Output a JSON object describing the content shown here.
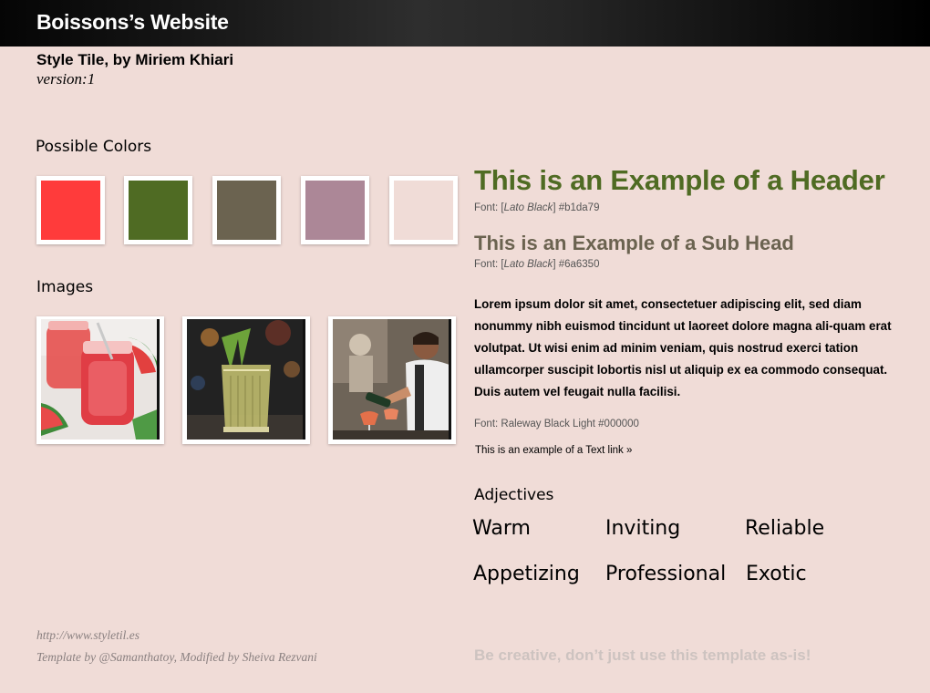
{
  "header": {
    "site_title": "Boissons’s Website"
  },
  "tile": {
    "author_line": "Style Tile, by Miriem Khiari",
    "version": "version:1"
  },
  "colors": {
    "label": "Possible Colors",
    "swatches": [
      {
        "hex": "#ff3b3b"
      },
      {
        "hex": "#4f6b23"
      },
      {
        "hex": "#6b6350"
      },
      {
        "hex": "#ac8797"
      },
      {
        "hex": "#f0dcd7"
      }
    ]
  },
  "images": {
    "label": "Images",
    "items": [
      "watermelon-juice-jars",
      "cocktail-glass",
      "bartender-pouring"
    ]
  },
  "typography": {
    "header_text": "This is an Example of a Header",
    "header_color": "#4f6b23",
    "header_font_prefix": "Font: [",
    "header_font_name": "Lato Black",
    "header_font_suffix": "]  #b1da79",
    "subhead_text": "This is an Example of a Sub Head",
    "subhead_color": "#6b6350",
    "subhead_font_prefix": "Font: [",
    "subhead_font_name": "Lato Black",
    "subhead_font_suffix": "]  #6a6350",
    "body_text": "Lorem ipsum dolor sit amet, consectetuer adipiscing elit, sed diam nonummy nibh euismod tincidunt ut laoreet dolore magna ali-quam erat volutpat. Ut wisi enim ad minim veniam, quis nostrud exerci tation ullamcorper suscipit lobortis nisl ut aliquip ex ea commodo consequat. Duis autem vel feugait nulla facilisi.",
    "body_font_note": "Font: Raleway Black Light #000000",
    "link_text": "This is an example of a Text link »"
  },
  "adjectives": {
    "label": "Adjectives",
    "words": [
      "Warm",
      "Inviting",
      "Reliable",
      "Appetizing",
      "Professional",
      "Exotic"
    ]
  },
  "footer": {
    "url": "http://www.styletil.es",
    "credit": "Template by @Samanthatoy, Modified by Sheiva Rezvani",
    "tagline": "Be creative, don’t just use this template as-is!"
  }
}
